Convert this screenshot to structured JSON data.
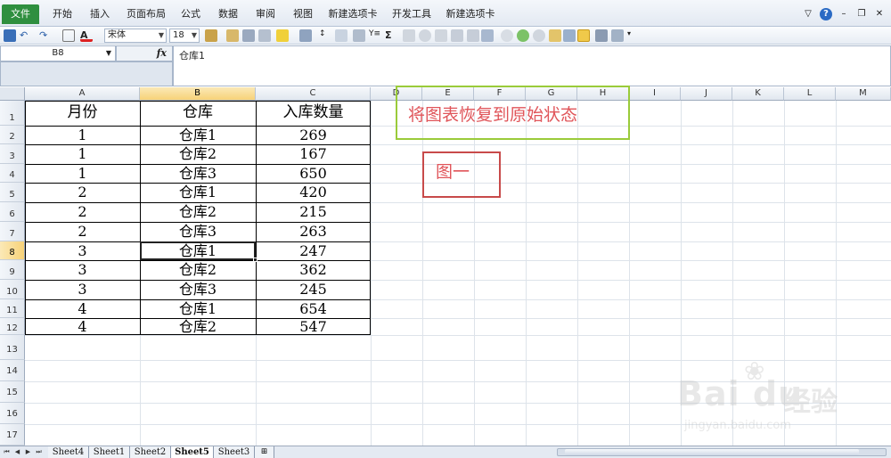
{
  "ribbon": {
    "tabs": [
      "文件",
      "开始",
      "插入",
      "页面布局",
      "公式",
      "数据",
      "审阅",
      "视图",
      "新建选项卡",
      "开发工具",
      "新建选项卡"
    ]
  },
  "toolbar": {
    "font_name": "宋体",
    "font_size": "18"
  },
  "formula_bar": {
    "name_box": "B8",
    "fx_label": "fx",
    "content": "仓库1"
  },
  "grid": {
    "columns": [
      "A",
      "B",
      "C",
      "D",
      "E",
      "F",
      "G",
      "H",
      "I",
      "J",
      "K",
      "L",
      "M"
    ],
    "rows": [
      "1",
      "2",
      "3",
      "4",
      "5",
      "6",
      "7",
      "8",
      "9",
      "10",
      "11",
      "12",
      "13",
      "14",
      "15",
      "16",
      "17"
    ],
    "selected_column": "B",
    "selected_row": "8"
  },
  "table": {
    "headers": [
      "月份",
      "仓库",
      "入库数量"
    ],
    "rows": [
      [
        "1",
        "仓库1",
        "269"
      ],
      [
        "1",
        "仓库2",
        "167"
      ],
      [
        "1",
        "仓库3",
        "650"
      ],
      [
        "2",
        "仓库1",
        "420"
      ],
      [
        "2",
        "仓库2",
        "215"
      ],
      [
        "2",
        "仓库3",
        "263"
      ],
      [
        "3",
        "仓库1",
        "247"
      ],
      [
        "3",
        "仓库2",
        "362"
      ],
      [
        "3",
        "仓库3",
        "245"
      ],
      [
        "4",
        "仓库1",
        "654"
      ],
      [
        "4",
        "仓库2",
        "547"
      ]
    ]
  },
  "annotations": {
    "green_note": "将图表恢复到原始状态",
    "red_note": "图一"
  },
  "sheets": {
    "tabs": [
      "Sheet4",
      "Sheet1",
      "Sheet2",
      "Sheet5",
      "Sheet3"
    ],
    "active": "Sheet5"
  },
  "watermark": {
    "logo": "Bai du",
    "cn": "经验",
    "url": "jingyan.baidu.com"
  },
  "colors": {
    "file_tab": "#2f8f3f",
    "selection_header": "#f7d278",
    "green_note_border": "#9acb3a",
    "red_note_border": "#c84a4a",
    "note_text": "#e0555a"
  }
}
